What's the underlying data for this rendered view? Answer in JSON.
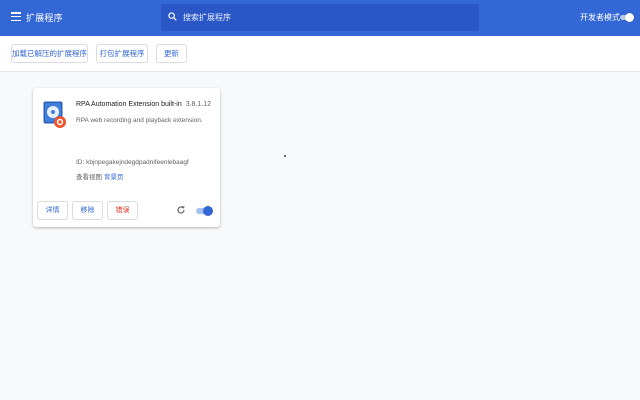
{
  "header": {
    "title": "扩展程序",
    "search_placeholder": "搜索扩展程序",
    "dev_mode_label": "开发者模式",
    "dev_mode_on": false
  },
  "toolbar": {
    "load_unpacked": "加载已解压的扩展程序",
    "pack": "打包扩展程序",
    "update": "更新"
  },
  "extension": {
    "name": "RPA Automation Extension built-in",
    "version": "3.8.1.12",
    "description": "RPA web recording and playback extension.",
    "id_label": "ID:",
    "id_value": "kbjnpegakejndegdpadnifeenlebaagf",
    "inspect_label": "查看视图",
    "inspect_link": "背景页",
    "details_button": "详情",
    "remove_button": "移除",
    "errors_button": "错误",
    "enabled": true
  },
  "colors": {
    "header_bg": "#3367d6",
    "accent": "#3367d6",
    "error": "#d93025"
  }
}
